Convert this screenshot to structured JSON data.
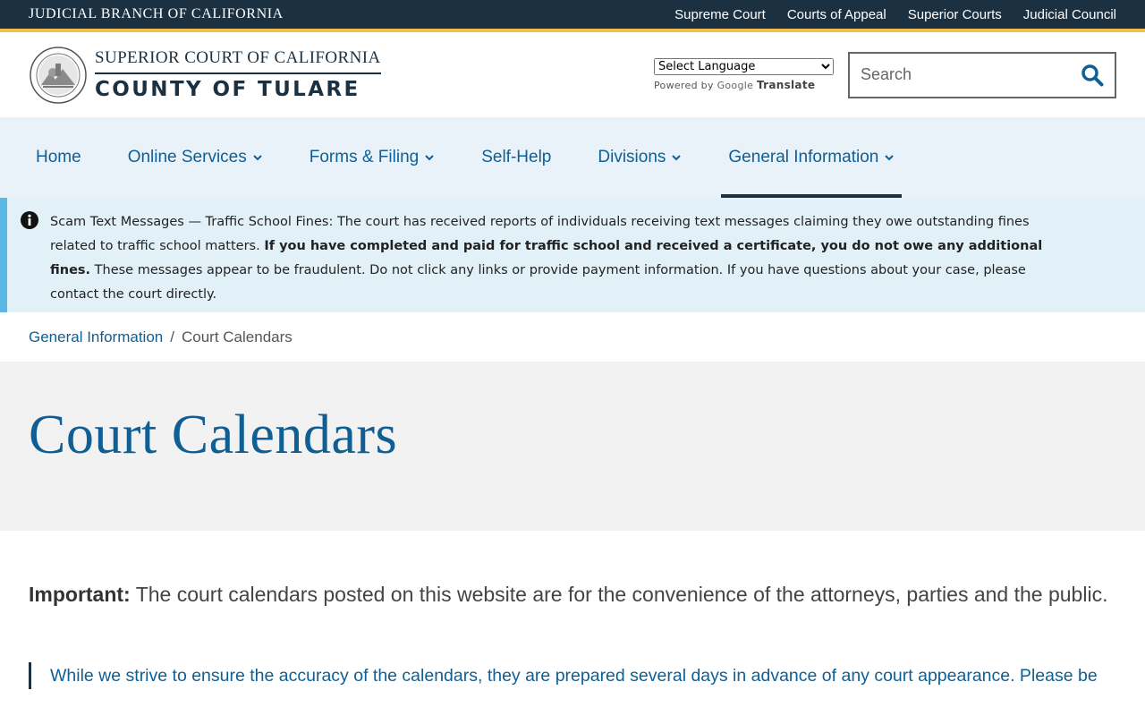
{
  "topbar": {
    "brand": "JUDICIAL BRANCH OF CALIFORNIA",
    "links": [
      "Supreme Court",
      "Courts of Appeal",
      "Superior Courts",
      "Judicial Council"
    ]
  },
  "header": {
    "logo_top": "SUPERIOR COURT OF CALIFORNIA",
    "logo_bottom": "COUNTY OF TULARE",
    "language_select": "Select Language",
    "powered_by": "Powered by",
    "google": "Google",
    "translate": "Translate",
    "search_placeholder": "Search"
  },
  "nav": {
    "items": [
      {
        "label": "Home"
      },
      {
        "label": "Online Services"
      },
      {
        "label": "Forms & Filing"
      },
      {
        "label": "Self-Help"
      },
      {
        "label": "Divisions"
      },
      {
        "label": "General Information"
      }
    ]
  },
  "alert": {
    "title": "Scam Text Messages — Traffic School Fines:",
    "text1": " The court has received reports of individuals receiving text messages claiming they owe outstanding fines related to traffic school matters. ",
    "bold": "If you have completed and paid for traffic school and received a certificate, you do not owe any additional fines.",
    "text2": " These messages appear to be fraudulent. Do not click any links or provide payment information. If you have questions about your case, please contact the court directly."
  },
  "breadcrumb": {
    "parent": "General Information",
    "separator": "/",
    "current": "Court Calendars"
  },
  "page": {
    "title": "Court Calendars",
    "important_label": "Important:",
    "important_text": " The court calendars posted on this website are for the convenience of the attorneys, parties and the public.",
    "quote_text": "While we strive to ensure the accuracy of the calendars, they are prepared several days in advance of any court appearance. Please be"
  },
  "colors": {
    "topbar_bg": "#1b3142",
    "topbar_accent": "#f1c04b",
    "link_blue": "#0f5f94",
    "nav_bg": "#e8f2f8",
    "alert_bg": "#e2f1f8",
    "alert_border": "#5bb7e4",
    "title_band_bg": "#f2f2f2"
  },
  "icons": {
    "seal": "court-seal-icon",
    "search": "search-icon",
    "chevron": "chevron-down-icon",
    "alert": "info-icon"
  }
}
